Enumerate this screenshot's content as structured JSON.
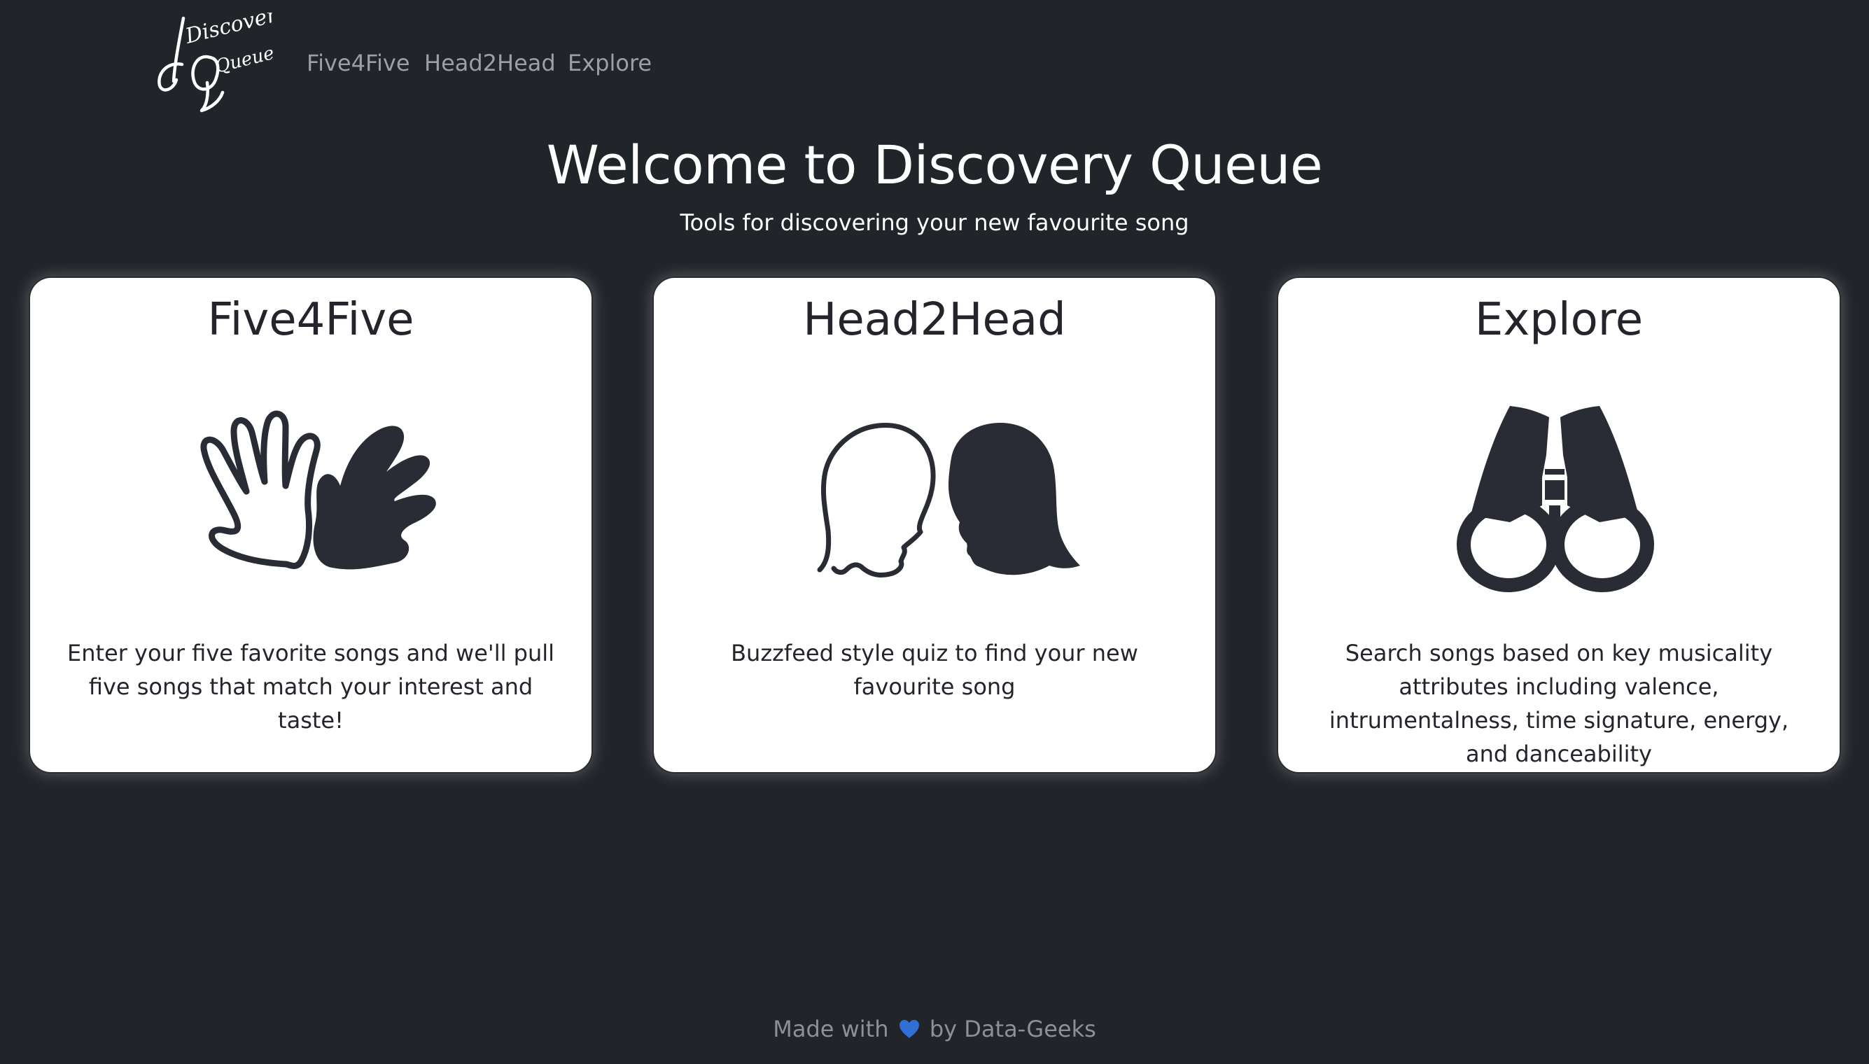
{
  "brand": {
    "logo_text_line1": "Discovery",
    "logo_text_line2": "Queue",
    "logo_icon": "discovery-queue-logo"
  },
  "nav": {
    "items": [
      {
        "label": "Five4Five"
      },
      {
        "label": "Head2Head"
      },
      {
        "label": "Explore"
      }
    ]
  },
  "hero": {
    "title": "Welcome to Discovery Queue",
    "subtitle": "Tools for discovering your new favourite song"
  },
  "cards": [
    {
      "title": "Five4Five",
      "icon": "hands-icon",
      "description": "Enter your five favorite songs and we'll pull five songs that match your interest and taste!"
    },
    {
      "title": "Head2Head",
      "icon": "heads-icon",
      "description": "Buzzfeed style quiz to find your new favourite song"
    },
    {
      "title": "Explore",
      "icon": "binoculars-icon",
      "description": "Search songs based on key musicality attributes including valence, intrumentalness, time signature, energy, and danceability"
    }
  ],
  "footer": {
    "prefix": "Made with",
    "icon": "blue-heart-icon",
    "suffix": "by Data-Geeks"
  },
  "colors": {
    "background": "#212429",
    "card_background": "#ffffff",
    "icon_dark": "#2a2c35",
    "nav_link": "#9aa0a6",
    "heart": "#2f6fd6"
  }
}
